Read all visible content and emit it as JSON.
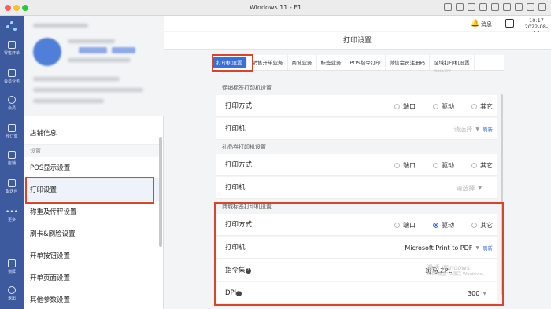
{
  "window": {
    "title": "Windows 11 - F1"
  },
  "rail": {
    "items": [
      {
        "label": "零售开单",
        "icon": "cart-icon"
      },
      {
        "label": "会员业务",
        "icon": "grid-icon"
      },
      {
        "label": "会员",
        "icon": "member-icon"
      },
      {
        "label": "预订单",
        "icon": "order-icon"
      },
      {
        "label": "店铺",
        "icon": "store-icon"
      },
      {
        "label": "配送台",
        "icon": "delivery-icon"
      },
      {
        "label": "更多",
        "icon": "more-icon"
      },
      {
        "label": "锁屏",
        "icon": "lock-icon"
      },
      {
        "label": "退出",
        "icon": "logout-icon"
      }
    ]
  },
  "store_panel": {
    "menu": {
      "store_info": "店铺信息",
      "section_settings": "设置",
      "pos_display": "POS显示设置",
      "print_settings": "打印设置",
      "scale_settings": "称重及传秤设置",
      "card_settings": "刷卡&刷脸设置",
      "open_button": "开单按钮设置",
      "open_page": "开单页面设置",
      "other_params": "其他参数设置"
    }
  },
  "topbar": {
    "message": "消息",
    "time": "10:17",
    "date": "2022-08-17"
  },
  "page": {
    "title": "打印设置",
    "tabs": [
      "打印机设置",
      "销售开单业务",
      "商城业务",
      "标签业务",
      "POS指令打印",
      "微信会员注册码",
      "区域打印机设置"
    ],
    "active_tab": "打印机设置",
    "tab_sub": "VIP&VIP卡"
  },
  "sections": [
    {
      "title": "促销标签打印机设置",
      "print_mode_label": "打印方式",
      "options": [
        "端口",
        "驱动",
        "其它"
      ],
      "selected": "",
      "printer_label": "打印机",
      "printer_value": "请选择",
      "refresh": "刷新"
    },
    {
      "title": "礼品券打印机设置",
      "print_mode_label": "打印方式",
      "options": [
        "端口",
        "驱动",
        "其它"
      ],
      "selected": "",
      "printer_label": "打印机",
      "printer_value": "请选择"
    },
    {
      "title": "商城标签打印机设置",
      "print_mode_label": "打印方式",
      "options": [
        "端口",
        "驱动",
        "其它"
      ],
      "selected": "驱动",
      "printer_label": "打印机",
      "printer_value": "Microsoft Print to PDF",
      "refresh": "刷新",
      "command_label": "指令集",
      "command_value": "斑马:ZPL",
      "dpi_label": "DPI",
      "dpi_value": "300"
    }
  ],
  "watermark": {
    "line1": "激活 Windows",
    "line2": "转到\"设置\"以激活 Windows。"
  },
  "colors": {
    "accent": "#3b6fd8",
    "rail": "#3d5a9e",
    "highlight": "#d9452c"
  }
}
